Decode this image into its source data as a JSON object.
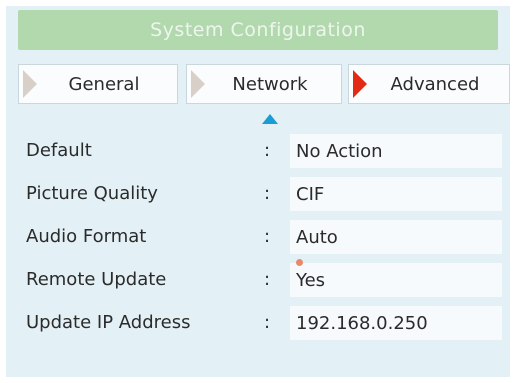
{
  "title": "System Configuration",
  "tabs": [
    {
      "label": "General",
      "active": false
    },
    {
      "label": "Network",
      "active": false
    },
    {
      "label": "Advanced",
      "active": true
    }
  ],
  "settings": [
    {
      "label": "Default",
      "separator": ":",
      "value": "No Action"
    },
    {
      "label": "Picture Quality",
      "separator": ":",
      "value": "CIF"
    },
    {
      "label": "Audio Format",
      "separator": ":",
      "value": "Auto"
    },
    {
      "label": "Remote Update",
      "separator": ":",
      "value": "Yes"
    },
    {
      "label": "Update IP Address",
      "separator": ":",
      "value": "192.168.0.250"
    }
  ],
  "colors": {
    "panel_background": "#e3f0f6",
    "title_bar": "#b2d8ae",
    "active_arrow": "#e22a14",
    "inactive_arrow": "#d7cfc8",
    "tab_indicator": "#1a9dd6"
  }
}
